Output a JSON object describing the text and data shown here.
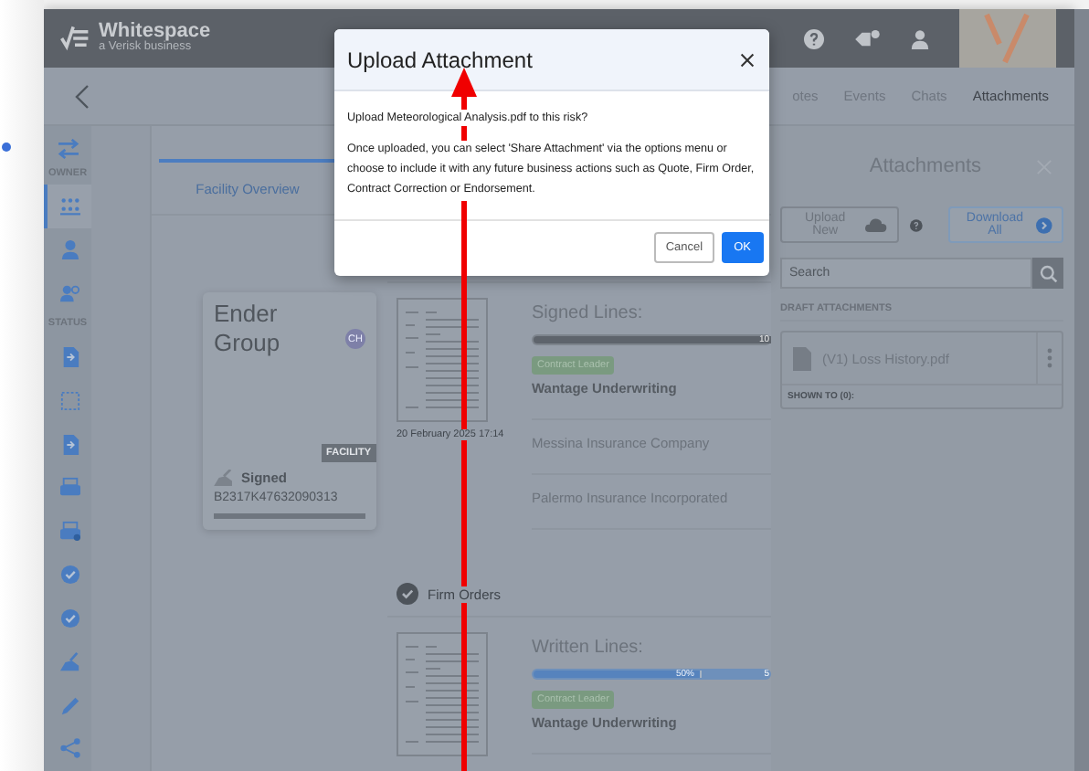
{
  "header": {
    "brand": "Whitespace",
    "tagline": "a Verisk business"
  },
  "panel_tabs": [
    {
      "label": "otes",
      "selected": false
    },
    {
      "label": "Events",
      "selected": false
    },
    {
      "label": "Chats",
      "selected": false
    },
    {
      "label": "Attachments",
      "selected": true
    }
  ],
  "sidebar": {
    "groups": [
      {
        "label": "OWNER",
        "items": [
          {
            "selected": true
          },
          {
            "selected": false
          },
          {
            "selected": false
          }
        ]
      },
      {
        "label": "STATUS",
        "items": [
          {
            "selected": false
          },
          {
            "selected": false
          },
          {
            "selected": false
          },
          {
            "selected": false
          },
          {
            "selected": false
          },
          {
            "selected": false
          },
          {
            "selected": false
          },
          {
            "selected": false
          },
          {
            "selected": false
          },
          {
            "selected": false
          }
        ]
      }
    ]
  },
  "main_tabs": [
    {
      "label": "Facility Overview",
      "selected": true
    }
  ],
  "facility_card": {
    "title": "Ender Group",
    "initials": "CH",
    "tag": "FACILITY",
    "status": "Signed",
    "reference": "B2317K47632090313",
    "level": 1
  },
  "sections": [
    {
      "date": "20 February 2025 17:14",
      "lines_title": "Signed Lines:",
      "bar": {
        "level": 1,
        "kind": "grey",
        "end_label": "10"
      },
      "participants": [
        {
          "tag": "Contract Leader",
          "name": "Wantage Underwriting",
          "leader": true
        },
        {
          "name": "Messina Insurance Company",
          "leader": false
        },
        {
          "name": "Palermo Insurance Incorporated",
          "leader": false
        }
      ]
    },
    {
      "title": "Firm Orders",
      "lines_title": "Written Lines:",
      "bar": {
        "level": 0.7,
        "kind": "blue",
        "label": "50%",
        "end_label": "5"
      },
      "participants": [
        {
          "tag": "Contract Leader",
          "name": "Wantage Underwriting",
          "leader": true
        }
      ]
    }
  ],
  "panel": {
    "title": "Attachments",
    "upload_button": "Upload New",
    "download_button": "Download All",
    "search": {
      "placeholder": "Search"
    },
    "draft_heading": "DRAFT ATTACHMENTS",
    "files": [
      {
        "name": "(V1) Loss History.pdf",
        "shown_to": "SHOWN TO (0):"
      }
    ]
  },
  "modal": {
    "title": "Upload Attachment",
    "question": "Upload Meteorological Analysis.pdf to this risk?",
    "message": "Once uploaded, you can select 'Share Attachment' via the options menu or choose to include it with any future business actions such as Quote, Firm Order, Contract Correction or Endorsement.",
    "cancel": "Cancel",
    "ok": "OK"
  }
}
